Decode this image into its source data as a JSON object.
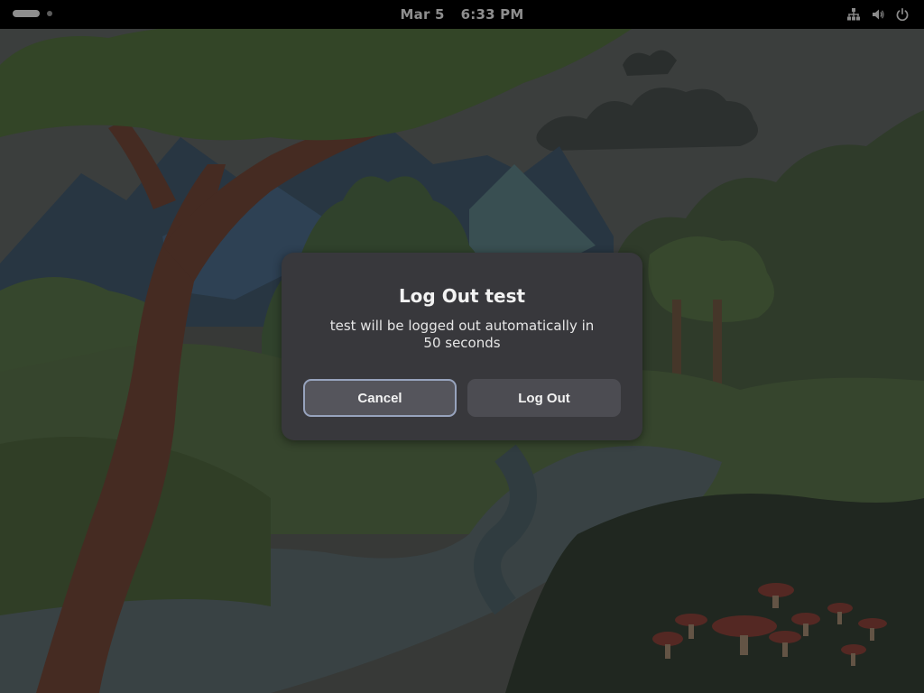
{
  "topbar": {
    "date": "Mar 5",
    "time": "6:33 PM",
    "icons": [
      "network-icon",
      "volume-icon",
      "power-icon"
    ]
  },
  "dialog": {
    "title": "Log Out test",
    "message": "test will be logged out automatically in 50 seconds",
    "cancel_label": "Cancel",
    "logout_label": "Log Out",
    "focused_button": "cancel"
  },
  "colors": {
    "dialog_bg": "#38383c",
    "button_bg": "#4c4c52",
    "focus_ring": "#97a3bd",
    "topbar_bg": "#000000"
  }
}
